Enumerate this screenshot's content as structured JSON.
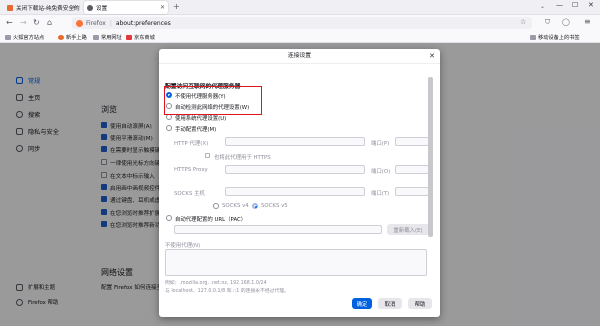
{
  "tabs": [
    {
      "label": "关闭下载站-纯免费安全的软件...",
      "active": false
    },
    {
      "label": "设置",
      "active": true
    }
  ],
  "urlbar": {
    "browser_label": "Firefox",
    "url": "about:preferences"
  },
  "bookmarks": {
    "items": [
      "火狐官方站点",
      "新手上路",
      "常用网址",
      "京东商城"
    ],
    "mobile": "移动设备上的书签"
  },
  "sidebar": {
    "items": [
      "常规",
      "主页",
      "搜索",
      "隐私与安全",
      "同步"
    ],
    "bottom": [
      "扩展和主题",
      "Firefox 帮助"
    ]
  },
  "page": {
    "browse_heading": "浏览",
    "options": [
      "使用自动滚屏(A)",
      "使用平滑滚动(M)",
      "在需要时显示触摸键盘",
      "一律使用光标方向键",
      "在文本中标示输入",
      "启用画中画视频控件",
      "通过键盘、耳机或虚拟...",
      "在您浏览时推荐扩展",
      "在您浏览时推荐新功能"
    ],
    "network_heading": "网络设置",
    "network_desc": "配置 Firefox 如何连接至互联网。"
  },
  "dialog": {
    "title": "连接设置",
    "section_title": "配置访问互联网的代理服务器",
    "no_proxy": "不使用代理服务器(Y)",
    "auto_detect": "自动检测此网络的代理设置(W)",
    "system_proxy": "使用系统代理设置(U)",
    "manual": "手动配置代理(M)",
    "http_proxy": "HTTP 代理(X)",
    "port1": "端口(P)",
    "also_https": "也将此代理用于 HTTPS",
    "https_proxy": "HTTPS Proxy",
    "port2": "端口(O)",
    "socks_host": "SOCKS 主机",
    "port3": "端口(T)",
    "socks4": "SOCKS v4",
    "socks5": "SOCKS v5",
    "auto_url": "自动代理配置的 URL（PAC）",
    "reload": "重新载入(E)",
    "no_proxy_for": "不使用代理(N)",
    "example": "例如：.mozilla.org, .net.nz, 192.168.1.0/24",
    "localhost_note": "与 localhost、127.0.0.1/8 和 ::1 的连接永不经过代理。",
    "ok": "确定",
    "cancel": "取消",
    "help": "帮助"
  },
  "colors": {
    "accent": "#0061e0",
    "highlight": "#e0141e"
  }
}
